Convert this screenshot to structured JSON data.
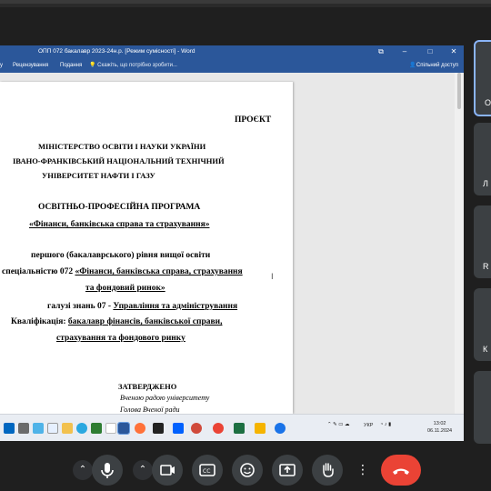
{
  "window": {
    "title": "ОПП 072 бакалавр 2023-24н.р. [Режим сумісності] - Word",
    "controls": {
      "restore": "⧉",
      "minimize": "–",
      "maximize": "□",
      "close": "✕"
    }
  },
  "ribbon": {
    "tabs": [
      "у",
      "Рецензування",
      "Подання"
    ],
    "tell_me": "Скажіть, що потрібно зробити...",
    "share": "Спільний доступ"
  },
  "document": {
    "line1": "ПРОЄКТ",
    "line2": "МІНІСТЕРСТВО ОСВІТИ І НАУКИ УКРАЇНИ",
    "line3": "ІВАНО-ФРАНКІВСЬКИЙ НАЦІОНАЛЬНИЙ ТЕХНІЧНИЙ",
    "line4": "УНІВЕРСИТЕТ НАФТИ І ГАЗУ",
    "line5": "ОСВІТНЬО-ПРОФЕСІЙНА ПРОГРАМА",
    "line6": "«Фінанси, банківська справа та страхування»",
    "line7": "першого (бакалаврського) рівня вищої освіти",
    "line8a": "спеціальністю  072 ",
    "line8b": "«Фінанси, банківська справа, страхування",
    "line9": "та фондовий ринок»",
    "line10a": "галузі знань 07 - ",
    "line10b": "Управління та адміністрування",
    "line11a": "Кваліфікація: ",
    "line11b": "бакалавр фінансів, банківської справи,",
    "line12": "страхування та фондового ринку",
    "line13": "ЗАТВЕРДЖЕНО",
    "line14": "Вченою радою університету",
    "line15": "Голова Вченої ради"
  },
  "taskbar": {
    "lang": "УКР",
    "time": "13:02",
    "date": "06.11.2024"
  },
  "tiles": [
    {
      "label": "О"
    },
    {
      "label": "Л"
    },
    {
      "label": "R"
    },
    {
      "label": "К"
    },
    {
      "label": ""
    }
  ],
  "icons": [
    "mic-icon",
    "camera-icon",
    "captions-icon",
    "emoji-icon",
    "present-icon",
    "raise-hand-icon",
    "more-icon",
    "end-call-icon"
  ],
  "colors": {
    "word_blue": "#2b579a",
    "end_call": "#ea4335",
    "tile_bg": "#3c4043",
    "active_border": "#8ab4f8"
  }
}
